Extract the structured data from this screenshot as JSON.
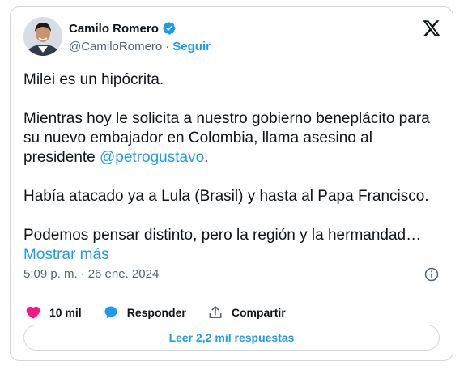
{
  "author": {
    "name": "Camilo Romero",
    "handle": "@CamiloRomero",
    "follow_label": "Seguir",
    "separator": "·"
  },
  "tweet": {
    "para1": "Milei es un hipócrita.",
    "para2_before": "Mientras hoy le solicita a nuestro gobierno beneplácito para su nuevo embajador en Colombia, llama asesino al presidente ",
    "mention": "@petrogustavo",
    "para2_after": ".",
    "para3": "Había atacado ya a Lula (Brasil) y hasta al Papa Francisco.",
    "para4": "Podemos pensar distinto, pero la región y la hermandad…",
    "show_more": "Mostrar más"
  },
  "meta": {
    "time": "5:09 p. m.",
    "separator": "·",
    "date": "26 ene. 2024"
  },
  "actions": {
    "likes_count": "10 mil",
    "reply_label": "Responder",
    "share_label": "Compartir"
  },
  "read_replies_label": "Leer 2,2 mil respuestas",
  "icons": {
    "verified": "verified-badge-icon",
    "x_logo": "x-logo-icon",
    "info": "info-icon",
    "like": "heart-icon",
    "reply": "speech-bubble-icon",
    "share": "share-upload-icon"
  },
  "colors": {
    "accent": "#1d9bf0",
    "like": "#f91880",
    "text": "#0f1419",
    "muted": "#536471",
    "border": "#cfd9de"
  }
}
